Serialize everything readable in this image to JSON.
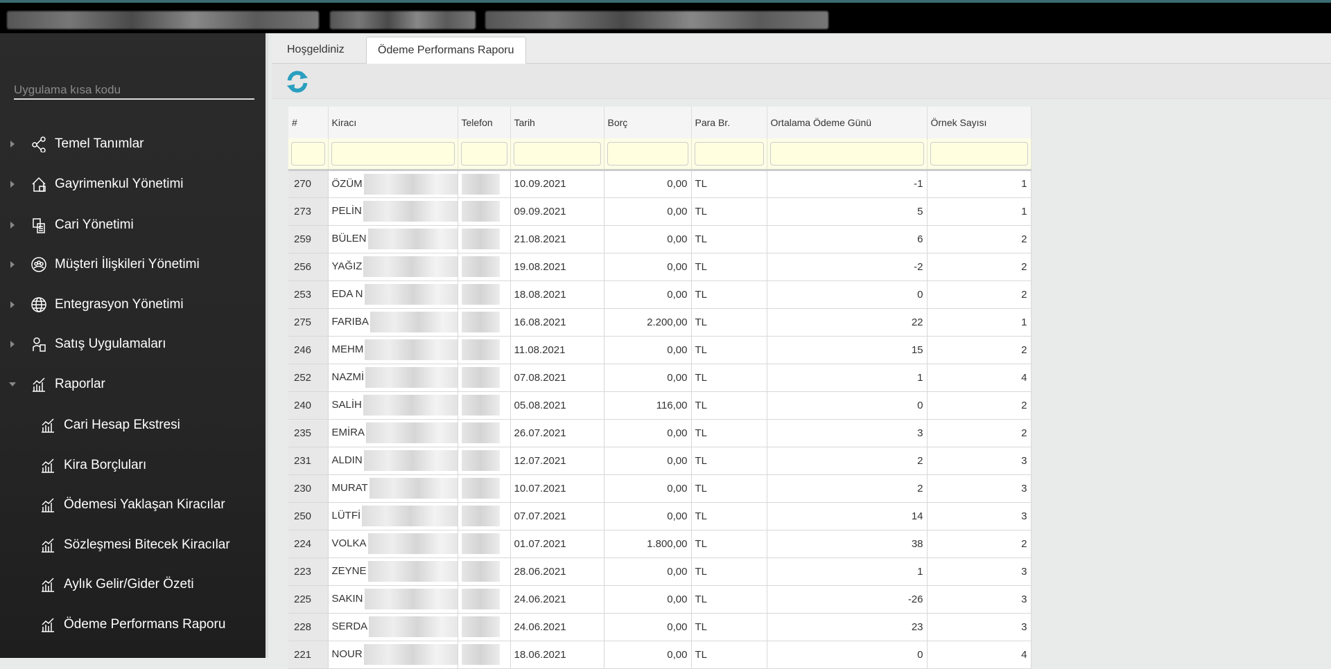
{
  "sidebar": {
    "search_placeholder": "Uygulama kısa kodu",
    "items": [
      {
        "label": "Temel Tanımlar",
        "icon": "share-nodes-icon"
      },
      {
        "label": "Gayrimenkul Yönetimi",
        "icon": "building-house-icon"
      },
      {
        "label": "Cari Yönetimi",
        "icon": "accounting-icon"
      },
      {
        "label": "Müşteri İlişkileri Yönetimi",
        "icon": "users-group-icon"
      },
      {
        "label": "Entegrasyon Yönetimi",
        "icon": "globe-icon"
      },
      {
        "label": "Satış Uygulamaları",
        "icon": "sales-icon"
      },
      {
        "label": "Raporlar",
        "icon": "chart-icon"
      }
    ],
    "report_items": [
      {
        "label": "Cari Hesap Ekstresi"
      },
      {
        "label": "Kira Borçluları"
      },
      {
        "label": "Ödemesi Yaklaşan Kiracılar"
      },
      {
        "label": "Sözleşmesi Bitecek Kiracılar"
      },
      {
        "label": "Aylık Gelir/Gider Özeti"
      },
      {
        "label": "Ödeme Performans Raporu"
      }
    ]
  },
  "tabs": [
    {
      "label": "Hoşgeldiniz"
    },
    {
      "label": "Ödeme Performans Raporu"
    }
  ],
  "toolbar": {
    "refresh_icon": "refresh-icon",
    "accent": "#2a9fbf"
  },
  "table": {
    "columns": [
      "#",
      "Kiracı",
      "Telefon",
      "Tarih",
      "Borç",
      "Para Br.",
      "Ortalama Ödeme Günü",
      "Örnek Sayısı"
    ],
    "rows": [
      [
        "270",
        "ÖZÜM",
        "",
        "10.09.2021",
        "0,00",
        "TL",
        "-1",
        "1"
      ],
      [
        "273",
        "PELİN",
        "",
        "09.09.2021",
        "0,00",
        "TL",
        "5",
        "1"
      ],
      [
        "259",
        "BÜLEN",
        "",
        "21.08.2021",
        "0,00",
        "TL",
        "6",
        "2"
      ],
      [
        "256",
        "YAĞIZ",
        "",
        "19.08.2021",
        "0,00",
        "TL",
        "-2",
        "2"
      ],
      [
        "253",
        "EDA N",
        "",
        "18.08.2021",
        "0,00",
        "TL",
        "0",
        "2"
      ],
      [
        "275",
        "FARIBA",
        "",
        "16.08.2021",
        "2.200,00",
        "TL",
        "22",
        "1"
      ],
      [
        "246",
        "MEHM",
        "",
        "11.08.2021",
        "0,00",
        "TL",
        "15",
        "2"
      ],
      [
        "252",
        "NAZMİ",
        "",
        "07.08.2021",
        "0,00",
        "TL",
        "1",
        "4"
      ],
      [
        "240",
        "SALİH",
        "",
        "05.08.2021",
        "116,00",
        "TL",
        "0",
        "2"
      ],
      [
        "235",
        "EMİRA",
        "",
        "26.07.2021",
        "0,00",
        "TL",
        "3",
        "2"
      ],
      [
        "231",
        "ALDIN",
        "",
        "12.07.2021",
        "0,00",
        "TL",
        "2",
        "3"
      ],
      [
        "230",
        "MURAT",
        "",
        "10.07.2021",
        "0,00",
        "TL",
        "2",
        "3"
      ],
      [
        "250",
        "LÜTFİ",
        "",
        "07.07.2021",
        "0,00",
        "TL",
        "14",
        "3"
      ],
      [
        "224",
        "VOLKA",
        "",
        "01.07.2021",
        "1.800,00",
        "TL",
        "38",
        "2"
      ],
      [
        "223",
        "ZEYNE",
        "",
        "28.06.2021",
        "0,00",
        "TL",
        "1",
        "3"
      ],
      [
        "225",
        "SAKIN",
        "",
        "24.06.2021",
        "0,00",
        "TL",
        "-26",
        "3"
      ],
      [
        "228",
        "SERDA",
        "",
        "24.06.2021",
        "0,00",
        "TL",
        "23",
        "3"
      ],
      [
        "221",
        "NOUR",
        "",
        "18.06.2021",
        "0,00",
        "TL",
        "0",
        "4"
      ]
    ]
  }
}
